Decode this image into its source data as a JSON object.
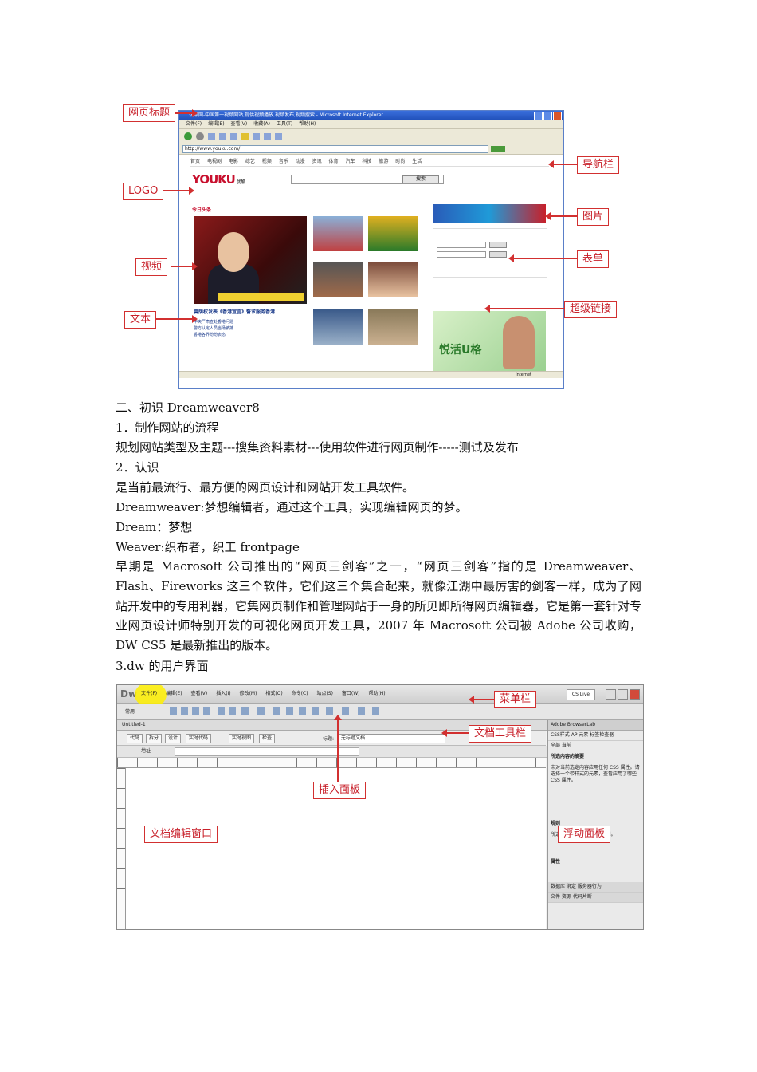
{
  "figure1": {
    "callouts": {
      "page_title": "网页标题",
      "logo": "LOGO",
      "video": "视频",
      "text": "文本",
      "navbar": "导航栏",
      "image": "图片",
      "form": "表单",
      "hyperlink": "超级链接"
    },
    "browser": {
      "window_title": "优酷网-中国第一视频网站,提供视频播放,视频发布,视频搜索 - Microsoft Internet Explorer",
      "menus": [
        "文件(F)",
        "编辑(E)",
        "查看(V)",
        "收藏(A)",
        "工具(T)",
        "帮助(H)"
      ],
      "address": "http://www.youku.com/",
      "nav_items": [
        "首页",
        "电视剧",
        "电影",
        "综艺",
        "视频",
        "音乐",
        "动漫",
        "资讯",
        "体育",
        "汽车",
        "科技",
        "旅游",
        "时尚",
        "生活"
      ],
      "logo_text": "YOUKU",
      "logo_sub": "优酷",
      "search_button": "搜索",
      "section_title": "今日头条",
      "video_title": "曾荫权发表《香港宣言》誓求服务香港",
      "text_items": [
        "中央严肃查处香港问题",
        "警方认定人员当场被捕",
        "香港各界纷纷表态"
      ],
      "ad_text": "悦活U格",
      "status": "Internet"
    }
  },
  "body": {
    "lines": [
      "二、初识 Dreamweaver8",
      "1．制作网站的流程",
      "规划网站类型及主题---搜集资料素材---使用软件进行网页制作-----测试及发布",
      "2．认识",
      "是当前最流行、最方便的网页设计和网站开发工具软件。",
      "Dreamweaver:梦想编辑者，通过这个工具，实现编辑网页的梦。",
      "Dream：梦想",
      "Weaver:织布者，织工 frontpage"
    ],
    "paragraph": "早期是 Macrosoft 公司推出的“网页三剑客”之一，“网页三剑客”指的是 Dreamweaver、Flash、Fireworks 这三个软件，它们这三个集合起来，就像江湖中最厉害的剑客一样，成为了网站开发中的专用利器，它集网页制作和管理网站于一身的所见即所得网页编辑器，它是第一套针对专业网页设计师特别开发的可视化网页开发工具，2007 年 Macrosoft 公司被 Adobe 公司收购，DW CS5 是最新推出的版本。",
    "heading3": "3.dw 的用户界面"
  },
  "figure2": {
    "callouts": {
      "menubar": "菜单栏",
      "doc_toolbar": "文档工具栏",
      "insert_panel": "插入面板",
      "doc_window": "文档编辑窗口",
      "float_panel": "浮动面板"
    },
    "dw": {
      "logo": "Dw",
      "menus": [
        "文件(F)",
        "编辑(E)",
        "查看(V)",
        "插入(I)",
        "修改(M)",
        "格式(O)",
        "命令(C)",
        "站点(S)",
        "窗口(W)",
        "帮助(H)"
      ],
      "cslive": "CS Live",
      "insert_tab": "常用",
      "doc_tab": "Untitled-1",
      "view_buttons": [
        "代码",
        "拆分",
        "设计",
        "实时代码",
        "实时视图",
        "检查"
      ],
      "title_label": "标题:",
      "title_value": "无标题文档",
      "address_label": "地址",
      "panel_header": "Adobe BrowserLab",
      "panel_tabs": "CSS样式  AP 元素  标签检查器",
      "panel_mode": "全部  当前",
      "panel_section": "所选内容的摘要",
      "panel_text": "未对当前选定内容应用任何 CSS 属性。请选择一个带样式的元素，查看应用了哪些 CSS 属性。",
      "panel_rules": "规则",
      "panel_rules_text": "所选标签没有应用 CSS 规则。",
      "panel_props": "属性",
      "panel_bottom1": "数据库  绑定  服务器行为",
      "panel_bottom2": "文件  资源  代码片断"
    }
  }
}
